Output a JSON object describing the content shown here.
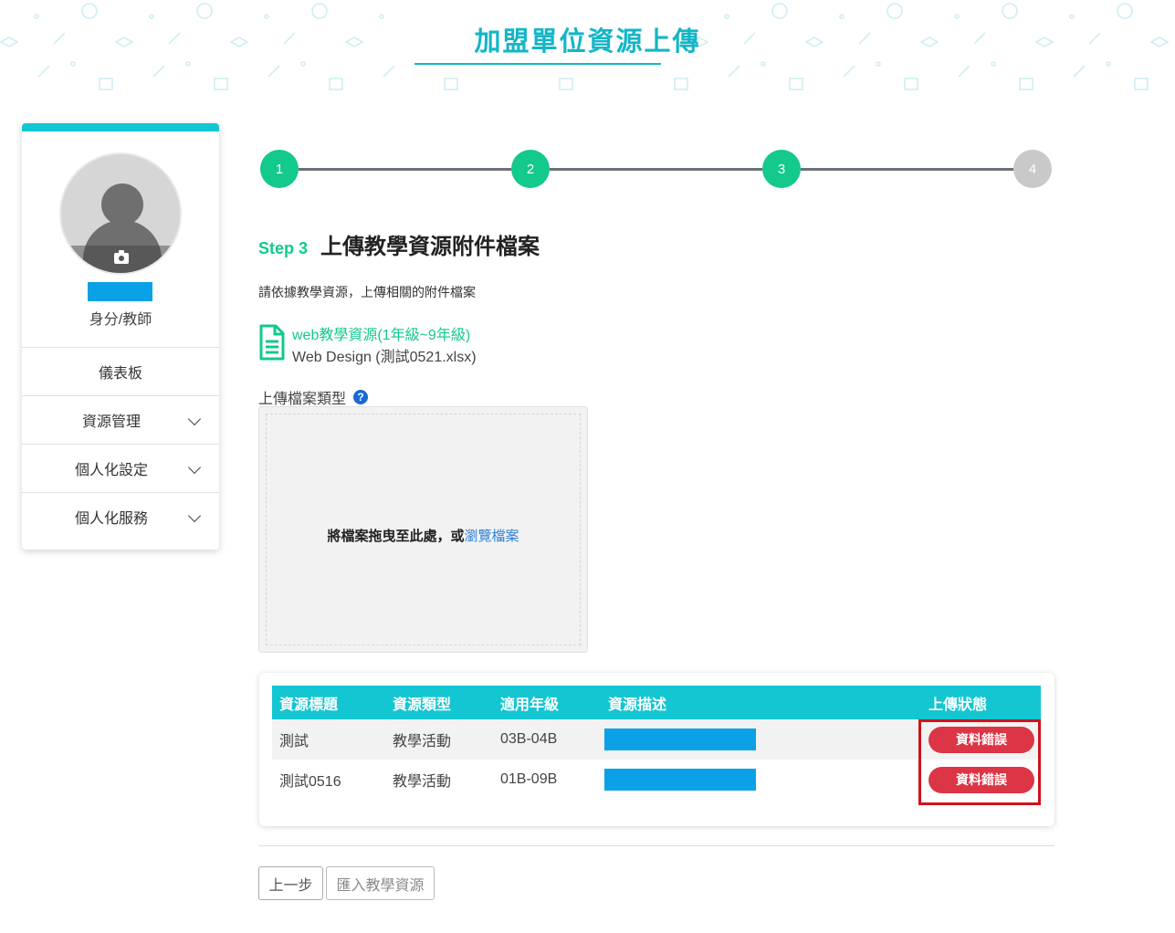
{
  "header": {
    "title": "加盟單位資源上傳"
  },
  "sidebar": {
    "role": "身分/教師",
    "items": [
      {
        "label": "儀表板",
        "has_sub": false
      },
      {
        "label": "資源管理",
        "has_sub": true
      },
      {
        "label": "個人化設定",
        "has_sub": true
      },
      {
        "label": "個人化服務",
        "has_sub": true
      }
    ]
  },
  "stepper": {
    "steps": [
      {
        "number": "1",
        "status": "done"
      },
      {
        "number": "2",
        "status": "done"
      },
      {
        "number": "3",
        "status": "done"
      },
      {
        "number": "4",
        "status": "todo"
      }
    ]
  },
  "step": {
    "prefix": "Step 3",
    "title": "上傳教學資源附件檔案",
    "description": "請依據教學資源，上傳相關的附件檔案"
  },
  "file": {
    "name": "web教學資源(1年級~9年級)",
    "subtitle": "Web Design (測試0521.xlsx)"
  },
  "upload": {
    "type_label": "上傳檔案類型",
    "help_icon": "?",
    "dropzone_text": "將檔案拖曳至此處，或",
    "dropzone_link": "瀏覽檔案"
  },
  "table": {
    "headers": [
      "資源標題",
      "資源類型",
      "適用年級",
      "資源描述",
      "上傳狀態"
    ],
    "rows": [
      {
        "title": "測試",
        "type": "教學活動",
        "grade": "03B-04B",
        "status": "資料錯誤"
      },
      {
        "title": "測試0516",
        "type": "教學活動",
        "grade": "01B-09B",
        "status": "資料錯誤"
      }
    ]
  },
  "buttons": {
    "prev": "上一步",
    "import": "匯入教學資源"
  },
  "colors": {
    "brand_teal": "#13b6c7",
    "step_green": "#13c98c",
    "error_red": "#dc3545",
    "redaction_blue": "#0aa1e6"
  }
}
